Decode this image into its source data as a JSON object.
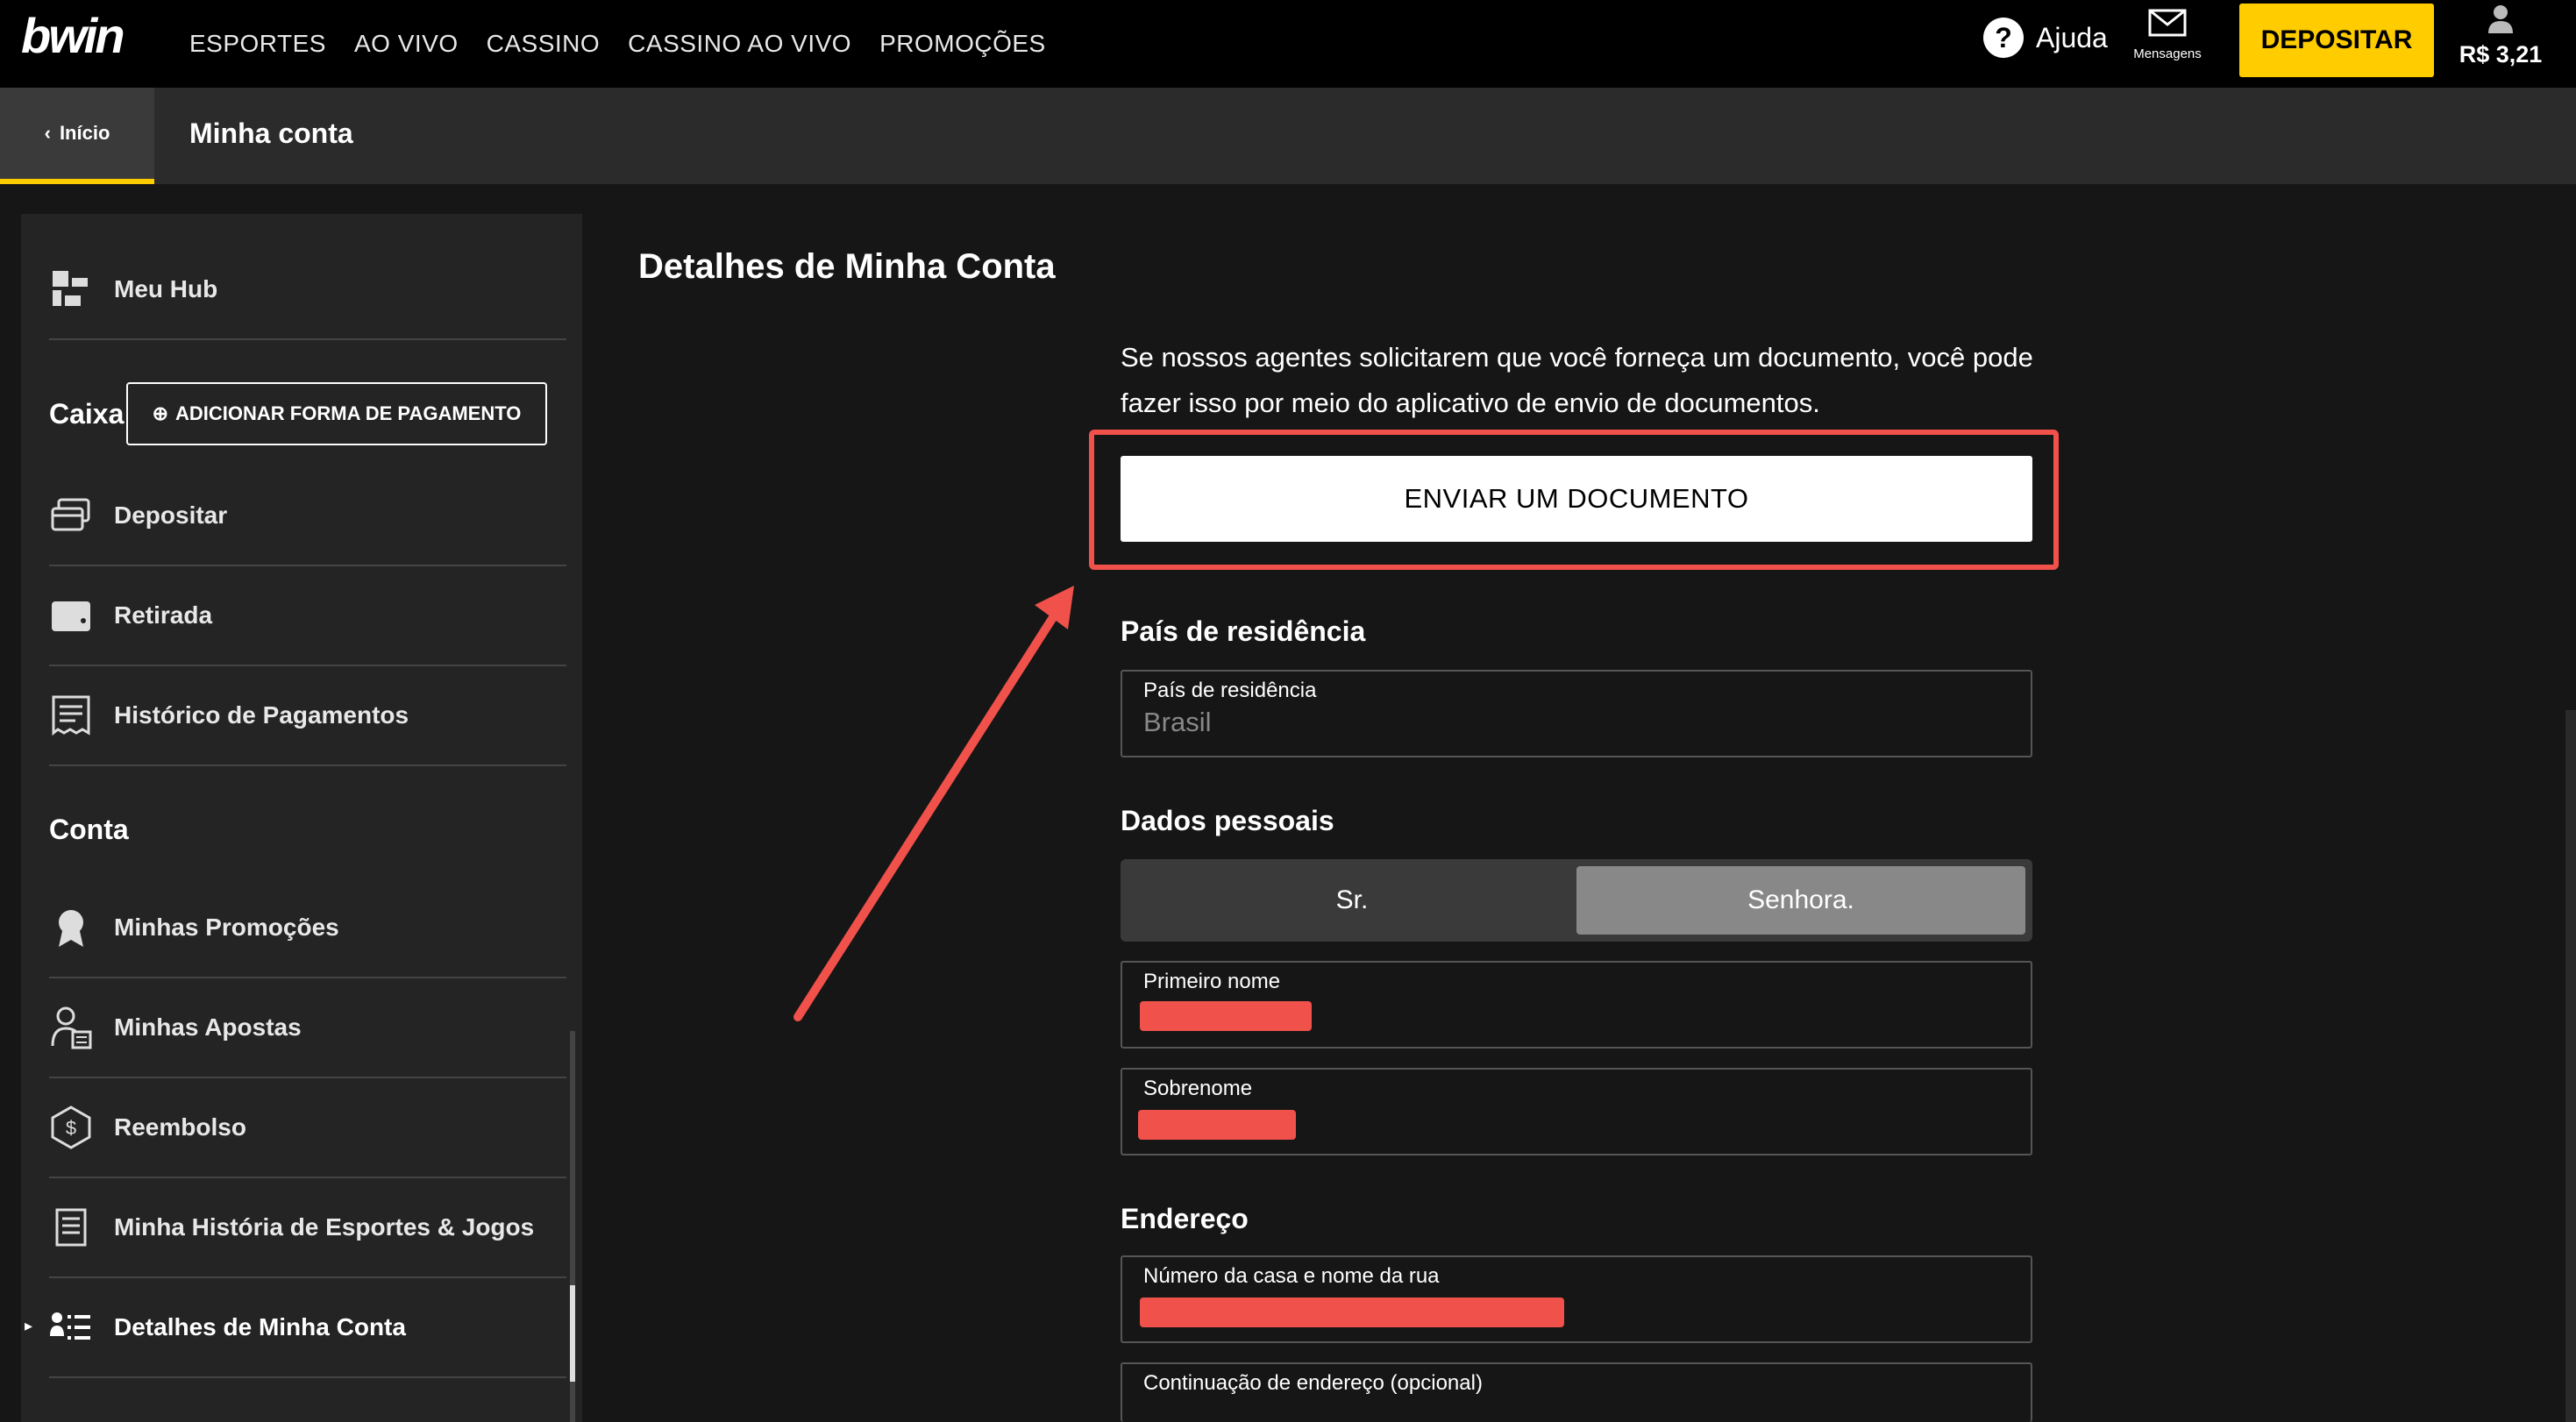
{
  "topbar": {
    "logo": "bwin",
    "nav": [
      "ESPORTES",
      "AO VIVO",
      "CASSINO",
      "CASSINO AO VIVO",
      "PROMOÇÕES"
    ],
    "help_icon": "?",
    "help_label": "Ajuda",
    "messages_label": "Mensagens",
    "deposit_label": "DEPOSITAR",
    "balance": "R$ 3,21"
  },
  "subbar": {
    "back_label": "Início",
    "title": "Minha conta"
  },
  "sidebar": {
    "hub": "Meu Hub",
    "cashier_heading": "Caixa",
    "add_payment": "ADICIONAR FORMA DE PAGAMENTO",
    "cashier_items": [
      "Depositar",
      "Retirada",
      "Histórico de Pagamentos"
    ],
    "account_heading": "Conta",
    "account_items": [
      "Minhas Promoções",
      "Minhas Apostas",
      "Reembolso",
      "Minha História de Esportes & Jogos",
      "Detalhes de Minha Conta"
    ]
  },
  "main": {
    "title": "Detalhes de Minha Conta",
    "info_text": "Se nossos agentes solicitarem que você forneça um documento, você pode fazer isso por meio do aplicativo de envio de documentos.",
    "send_button": "ENVIAR UM DOCUMENTO",
    "residence_heading": "País de residência",
    "residence_label": "País de residência",
    "residence_value": "Brasil",
    "personal_heading": "Dados pessoais",
    "title_options": [
      "Sr.",
      "Senhora."
    ],
    "title_selected": "Senhora.",
    "first_name_label": "Primeiro nome",
    "last_name_label": "Sobrenome",
    "address_heading": "Endereço",
    "street_label": "Número da casa e nome da rua",
    "address2_label": "Continuação de endereço (opcional)"
  },
  "colors": {
    "accent": "#ffcc00",
    "highlight": "#f0514a",
    "background": "#161616"
  }
}
